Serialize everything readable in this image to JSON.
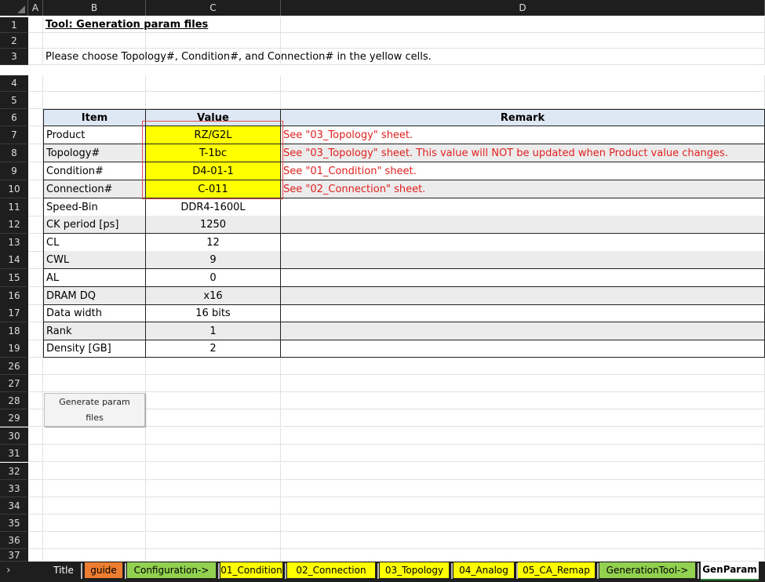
{
  "columns": [
    "A",
    "B",
    "C",
    "D"
  ],
  "title": "Tool: Generation param files",
  "instruction": "Please choose Topology#, Condition#, and Connection# in the yellow cells.",
  "table": {
    "headers": {
      "item": "Item",
      "value": "Value",
      "remark": "Remark"
    },
    "rows": [
      {
        "row": "7",
        "item": "Product",
        "value": "RZ/G2L",
        "remark": "See \"03_Topology\" sheet."
      },
      {
        "row": "8",
        "item": "Topology#",
        "value": "T-1bc",
        "remark": "See \"03_Topology\" sheet. This value will NOT be updated when Product value changes."
      },
      {
        "row": "9",
        "item": "Condition#",
        "value": "D4-01-1",
        "remark": "See \"01_Condition\" sheet."
      },
      {
        "row": "10",
        "item": "Connection#",
        "value": "C-011",
        "remark": "See \"02_Connection\" sheet."
      },
      {
        "row": "11",
        "item": "Speed-Bin",
        "value": "DDR4-1600L",
        "remark": ""
      },
      {
        "row": "12",
        "item": "CK period [ps]",
        "value": "1250",
        "remark": ""
      },
      {
        "row": "13",
        "item": "CL",
        "value": "12",
        "remark": ""
      },
      {
        "row": "14",
        "item": "CWL",
        "value": "9",
        "remark": ""
      },
      {
        "row": "15",
        "item": "AL",
        "value": "0",
        "remark": ""
      },
      {
        "row": "16",
        "item": "DRAM DQ",
        "value": "x16",
        "remark": ""
      },
      {
        "row": "17",
        "item": "Data width",
        "value": "16 bits",
        "remark": ""
      },
      {
        "row": "18",
        "item": "Rank",
        "value": "1",
        "remark": ""
      },
      {
        "row": "19",
        "item": "Density [GB]",
        "value": "2",
        "remark": ""
      }
    ]
  },
  "generate_button": "Generate param files",
  "row_numbers": [
    "1",
    "2",
    "3",
    "4",
    "5",
    "6",
    "7",
    "8",
    "9",
    "10",
    "11",
    "12",
    "13",
    "14",
    "15",
    "16",
    "17",
    "18",
    "19",
    "26",
    "27",
    "28",
    "29",
    "30",
    "31",
    "32",
    "33",
    "34",
    "35",
    "36",
    "37"
  ],
  "tabs": [
    {
      "label": "Title",
      "color": "#1e1e1e",
      "text": "#ffffff"
    },
    {
      "label": "guide",
      "color": "#ed7d31",
      "text": "#000000"
    },
    {
      "label": "Configuration->",
      "color": "#92d050",
      "text": "#000000"
    },
    {
      "label": "01_Condition",
      "color": "#ffff00",
      "text": "#000000"
    },
    {
      "label": "02_Connection",
      "color": "#ffff00",
      "text": "#000000"
    },
    {
      "label": "03_Topology",
      "color": "#ffff00",
      "text": "#000000"
    },
    {
      "label": "04_Analog",
      "color": "#ffff00",
      "text": "#000000"
    },
    {
      "label": "05_CA_Remap",
      "color": "#ffff00",
      "text": "#000000"
    },
    {
      "label": "GenerationTool->",
      "color": "#92d050",
      "text": "#000000"
    },
    {
      "label": "GenParam",
      "color": "#ffffff",
      "text": "#000000",
      "active": true
    }
  ],
  "nav_arrow": "›",
  "colors": {
    "header_fill": "#dde8f4",
    "input_fill": "#ffff00",
    "remark_red": "#e0201e",
    "alt_row": "#ececec",
    "selection_border": "#e25050"
  }
}
